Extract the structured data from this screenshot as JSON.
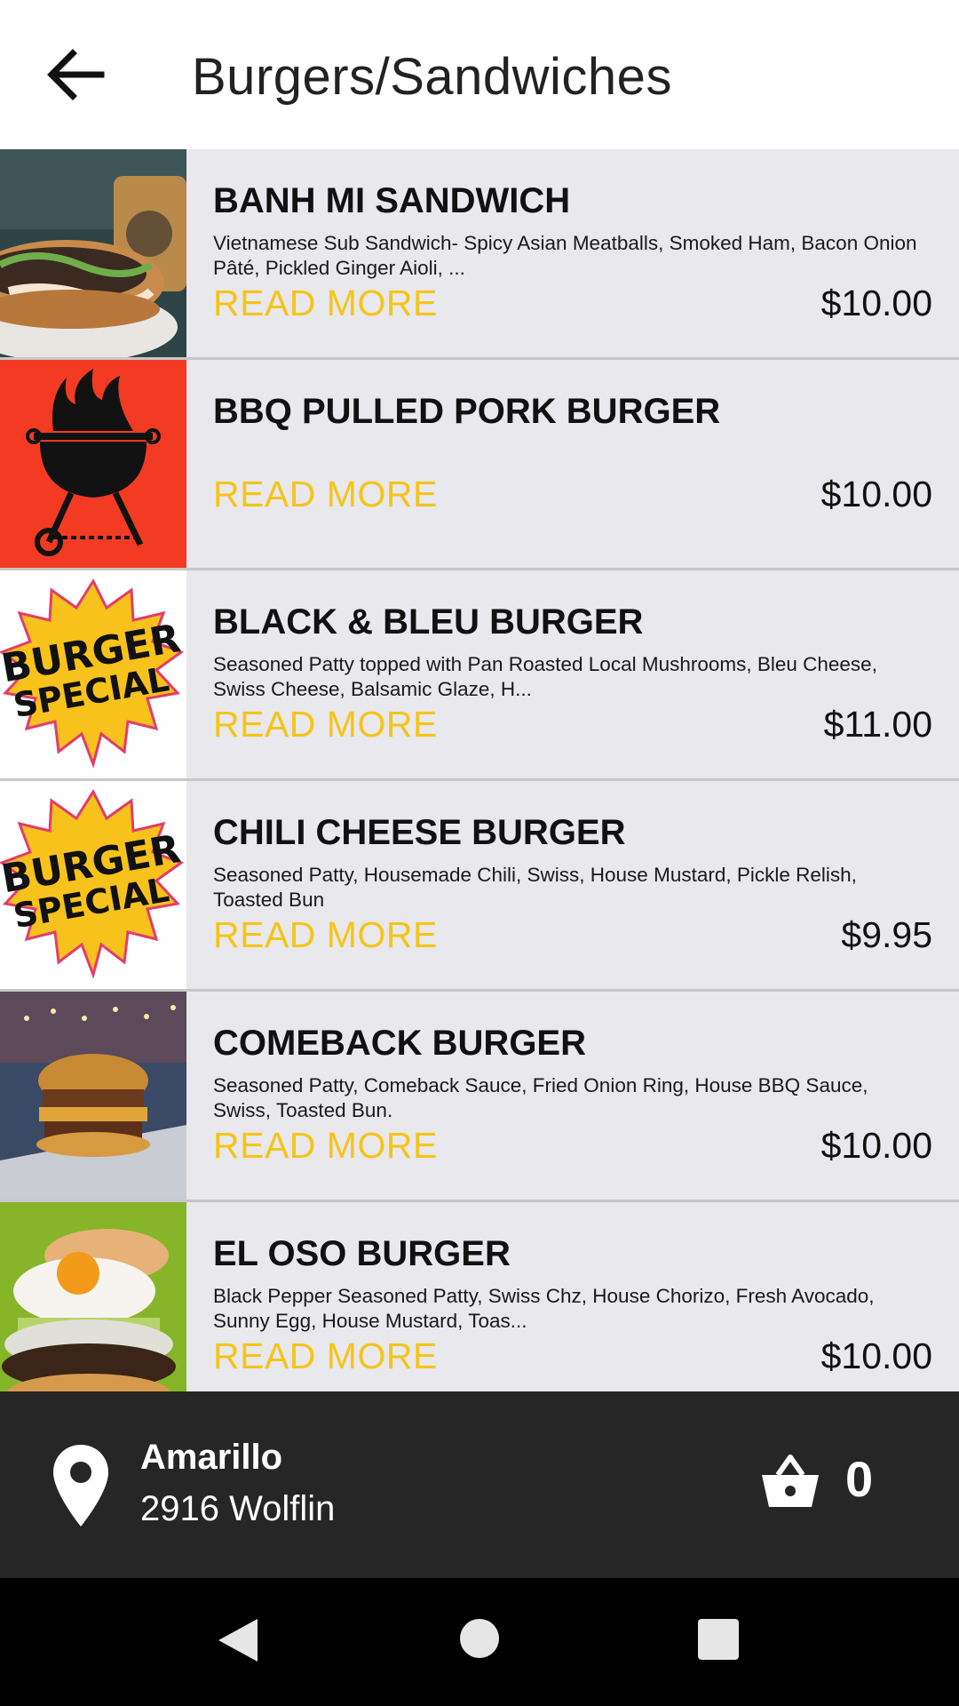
{
  "header": {
    "back_icon": "arrow-left-icon",
    "title": "Burgers/Sandwiches"
  },
  "items": [
    {
      "name": "BANH MI SANDWICH",
      "description": "Vietnamese Sub Sandwich- Spicy Asian Meatballs, Smoked Ham, Bacon Onion Pâté, Pickled Ginger Aioli, ...",
      "read_more": "READ MORE",
      "price": "$10.00",
      "image": "banh-mi-photo"
    },
    {
      "name": "BBQ PULLED PORK BURGER",
      "description": "",
      "read_more": "READ MORE",
      "price": "$10.00",
      "image": "bbq-grill-logo"
    },
    {
      "name": "BLACK & BLEU BURGER",
      "description": "Seasoned Patty topped with Pan Roasted Local Mushrooms, Bleu Cheese, Swiss Cheese, Balsamic Glaze, H...",
      "read_more": "READ MORE",
      "price": "$11.00",
      "image": "burger-special-badge"
    },
    {
      "name": "CHILI CHEESE BURGER",
      "description": "Seasoned Patty, Housemade Chili, Swiss, House Mustard, Pickle Relish, Toasted Bun",
      "read_more": "READ MORE",
      "price": "$9.95",
      "image": "burger-special-badge"
    },
    {
      "name": "COMEBACK BURGER",
      "description": "Seasoned Patty, Comeback Sauce, Fried Onion Ring, House BBQ Sauce, Swiss, Toasted Bun.",
      "read_more": "READ MORE",
      "price": "$10.00",
      "image": "comeback-burger-photo"
    },
    {
      "name": "EL OSO BURGER",
      "description": "Black Pepper Seasoned Patty, Swiss Chz, House Chorizo, Fresh Avocado, Sunny Egg, House Mustard, Toas...",
      "read_more": "READ MORE",
      "price": "$10.00",
      "image": "el-oso-burger-photo"
    }
  ],
  "badge_text": [
    "BURGER",
    "SPECIAL"
  ],
  "footer": {
    "location_icon": "map-pin-icon",
    "city": "Amarillo",
    "address": "2916 Wolflin",
    "cart_icon": "shopping-basket-icon",
    "cart_count": "0"
  },
  "system_nav": {
    "back": "nav-back-icon",
    "home": "nav-home-icon",
    "recents": "nav-recents-icon"
  },
  "colors": {
    "accent": "#f5c518",
    "row_bg": "#e8e8ed",
    "footer_bg": "#262626",
    "nav_bg": "#000000"
  }
}
